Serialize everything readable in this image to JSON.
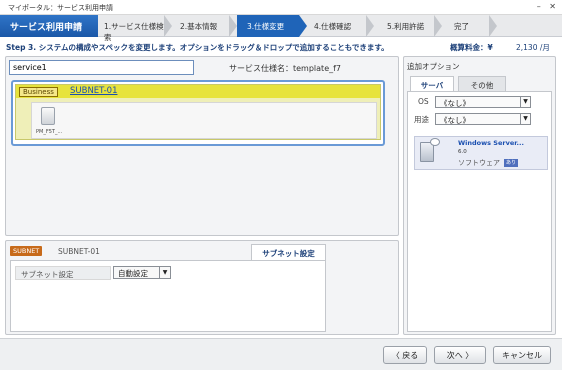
{
  "window": {
    "title": "マイポータル：サービス利用申請",
    "minimize_glyph": "–",
    "close_glyph": "✕"
  },
  "wizard": {
    "main_title": "サービス利用申請",
    "steps": [
      {
        "label": "1.サービス仕様検索",
        "active": false
      },
      {
        "label": "2.基本情報",
        "active": false
      },
      {
        "label": "3.仕様変更",
        "active": true
      },
      {
        "label": "4.仕様確認",
        "active": false
      },
      {
        "label": "5.利用許諾",
        "active": false
      },
      {
        "label": "完了",
        "active": false
      }
    ]
  },
  "instruction": "Step 3. システムの構成やスペックを変更します。オプションをドラッグ＆ドロップで追加することもできます。",
  "fee": {
    "label": "概算料金：¥",
    "value": "2,130 /月"
  },
  "main": {
    "service_name_value": "service1",
    "spec_label": "サービス仕様名：template_f7",
    "business_tag": "Business",
    "subnet_link": "SUBNET-01",
    "server_label": "PM_F5T_..."
  },
  "subnet_panel": {
    "tag": "SUBNET",
    "name": "SUBNET-01",
    "tab_label": "サブネット設定",
    "row_label": "サブネット設定",
    "row_value": "自動設定",
    "arrow_glyph": "▼"
  },
  "options": {
    "title": "追加オプション",
    "tabs": [
      "サーバ",
      "その他"
    ],
    "filters": [
      {
        "label": "OS",
        "value": "《なし》"
      },
      {
        "label": "用途",
        "value": "《なし》"
      }
    ],
    "card": {
      "name": "Windows Server...",
      "version": "6.0",
      "type": "ソフトウェア",
      "badge": "あり"
    }
  },
  "footer": {
    "back": "〈 戻る",
    "next": "次へ 〉",
    "cancel": "キャンセル"
  },
  "colors": {
    "accent_blue": "#1f64b8",
    "business_yellow": "#e7e33c",
    "subnet_orange": "#c76a1a"
  }
}
